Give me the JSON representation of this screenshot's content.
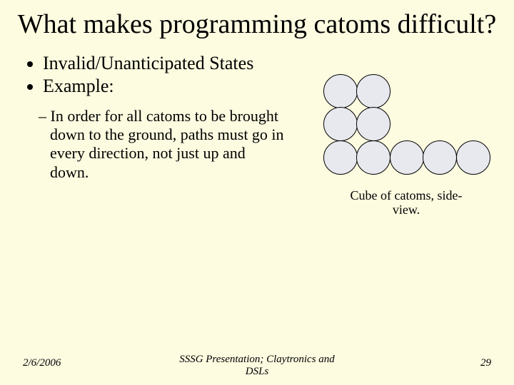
{
  "title": "What makes programming catoms difficult?",
  "bullets": {
    "b1": "Invalid/Unanticipated States",
    "b2": "Example:",
    "sub1": "In order for all catoms to be brought down to the ground, paths must go in every direction, not just up and down."
  },
  "caption_line1": "Cube of catoms, side-",
  "caption_line2": "view.",
  "footer": {
    "date": "2/6/2006",
    "center_line1": "SSSG Presentation; Claytronics and",
    "center_line2": "DSLs",
    "pagenum": "29"
  }
}
